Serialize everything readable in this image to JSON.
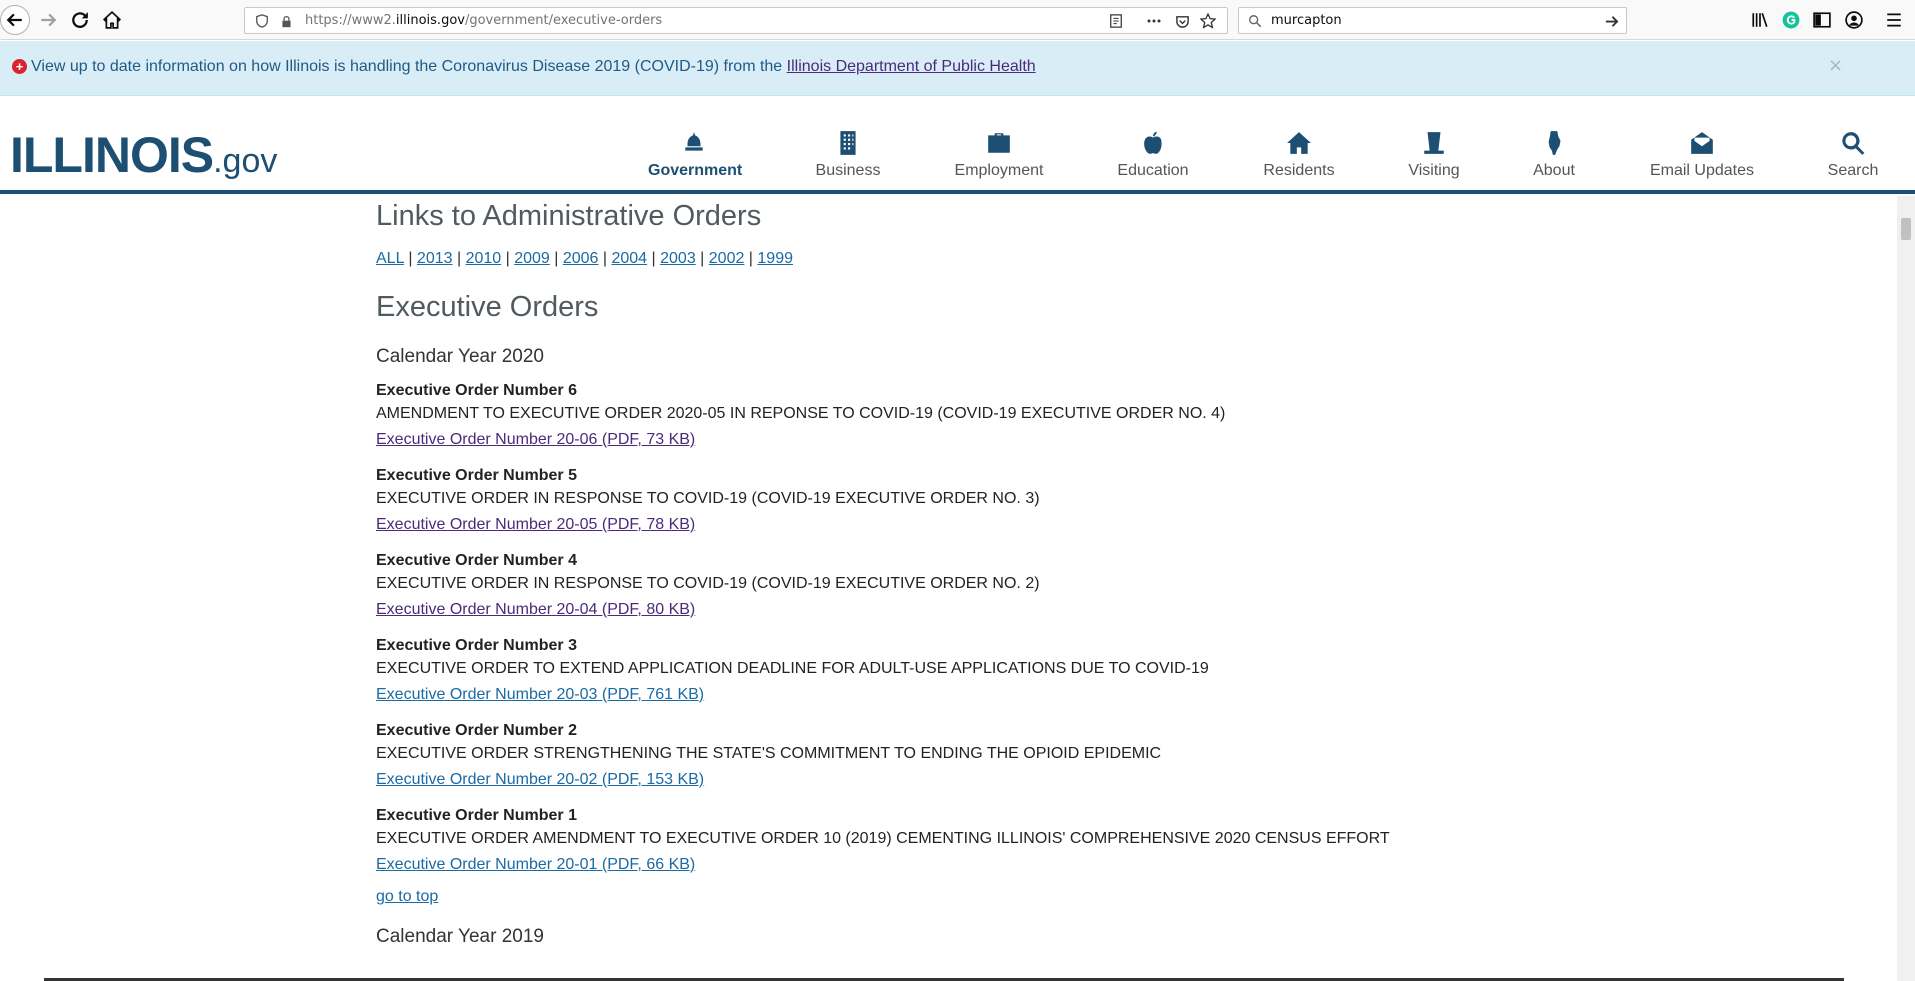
{
  "browser": {
    "url_prefix": "https://www2.",
    "url_domain": "illinois.gov",
    "url_path": "/government/executive-orders",
    "search_value": "murcapton"
  },
  "alert": {
    "message": "View up to date information on how Illinois is handling the Coronavirus Disease 2019 (COVID-19) from the ",
    "link": "Illinois Department of Public Health",
    "close": "×"
  },
  "logo": {
    "main": "ILLINOIS",
    "suffix": ".gov"
  },
  "nav": [
    {
      "label": "Government",
      "icon": "capitol-icon"
    },
    {
      "label": "Business",
      "icon": "building-icon"
    },
    {
      "label": "Employment",
      "icon": "briefcase-icon"
    },
    {
      "label": "Education",
      "icon": "apple-icon"
    },
    {
      "label": "Residents",
      "icon": "house-icon"
    },
    {
      "label": "Visiting",
      "icon": "hat-icon"
    },
    {
      "label": "About",
      "icon": "illinois-icon"
    },
    {
      "label": "Email Updates",
      "icon": "envelope-icon"
    },
    {
      "label": "Search",
      "icon": "search-icon"
    }
  ],
  "content": {
    "admin_heading": "Links to Administrative Orders",
    "year_links": [
      "ALL",
      "2013",
      "2010",
      "2009",
      "2006",
      "2004",
      "2003",
      "2002",
      "1999"
    ],
    "separator": " | ",
    "exec_heading": "Executive Orders",
    "calendar_2020": "Calendar Year 2020",
    "orders": [
      {
        "number": "Executive Order Number 6",
        "desc": "AMENDMENT TO EXECUTIVE ORDER 2020-05 IN REPONSE TO COVID-19 (COVID-19 EXECUTIVE ORDER NO. 4)",
        "link": "Executive Order Number 20-06 (PDF, 73 KB)"
      },
      {
        "number": "Executive Order Number 5",
        "desc": "EXECUTIVE ORDER IN RESPONSE TO COVID-19 (COVID-19 EXECUTIVE ORDER NO. 3)",
        "link": "Executive Order Number 20-05 (PDF, 78 KB)"
      },
      {
        "number": "Executive Order Number 4",
        "desc": "EXECUTIVE ORDER IN RESPONSE TO COVID-19 (COVID-19 EXECUTIVE ORDER NO. 2)",
        "link": "Executive Order Number 20-04 (PDF, 80 KB)"
      },
      {
        "number": "Executive Order Number 3",
        "desc": "EXECUTIVE ORDER TO EXTEND APPLICATION DEADLINE FOR ADULT-USE APPLICATIONS DUE TO COVID-19",
        "link": "Executive Order Number 20-03 (PDF, 761 KB)"
      },
      {
        "number": "Executive Order Number 2",
        "desc": "EXECUTIVE ORDER STRENGTHENING THE STATE'S COMMITMENT TO ENDING THE OPIOID EPIDEMIC",
        "link": "Executive Order Number 20-02 (PDF, 153 KB)"
      },
      {
        "number": "Executive Order Number 1",
        "desc": "EXECUTIVE ORDER AMENDMENT TO EXECUTIVE ORDER 10 (2019) CEMENTING ILLINOIS' COMPREHENSIVE 2020 CENSUS EFFORT",
        "link": "Executive Order Number 20-01 (PDF, 66 KB)"
      }
    ],
    "go_to_top": "go to top",
    "calendar_2019": "Calendar Year 2019"
  }
}
